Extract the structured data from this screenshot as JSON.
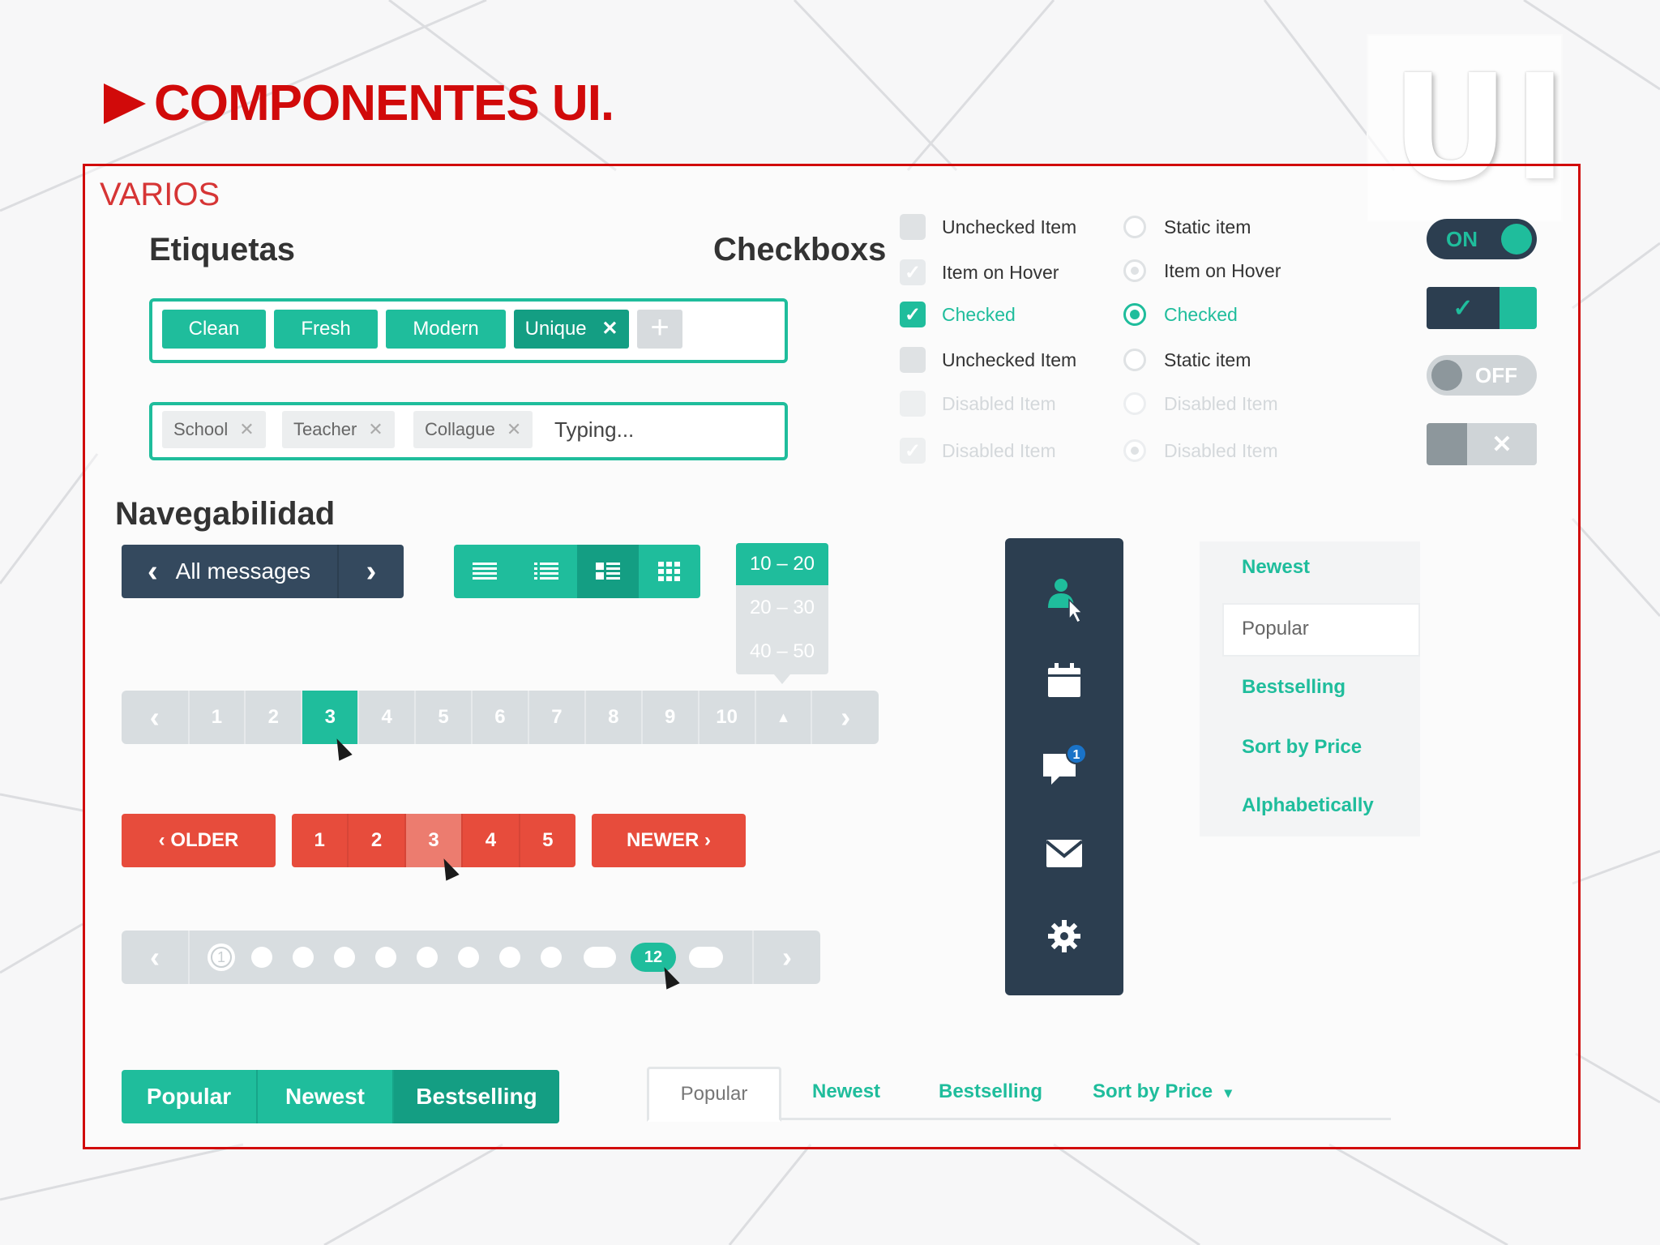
{
  "slide": {
    "title": "COMPONENTES UI.",
    "logo_text": "UI",
    "section": "VARIOS"
  },
  "colors": {
    "accent": "#1fbd9c",
    "accent_dark": "#149e83",
    "navy": "#2c3e50",
    "red": "#e74c3c",
    "title_red": "#d10a0a"
  },
  "etiquetas": {
    "title": "Etiquetas",
    "tags": [
      "Clean",
      "Fresh",
      "Modern",
      "Unique"
    ],
    "remove_glyph": "✕",
    "add_glyph": "+",
    "grey_tags": [
      "School",
      "Teacher",
      "Collague"
    ],
    "typing": "Typing..."
  },
  "checkboxs": {
    "title": "Checkboxs",
    "checkboxes": [
      "Unchecked Item",
      "Item on Hover",
      "Checked",
      "Unchecked Item",
      "Disabled Item",
      "Disabled Item"
    ],
    "radios": [
      "Static item",
      "Item on Hover",
      "Checked",
      "Static item",
      "Disabled Item",
      "Disabled Item"
    ],
    "check_glyph": "✓"
  },
  "toggles": {
    "on_label": "ON",
    "off_label": "OFF",
    "check_glyph": "✓",
    "x_glyph": "✕"
  },
  "navegabilidad": {
    "title": "Navegabilidad",
    "message_nav": {
      "label": "All messages",
      "prev": "‹",
      "next": "›"
    },
    "range_dropdown": [
      "10 – 20",
      "20 – 30",
      "40 – 50"
    ],
    "pager": {
      "prev": "‹",
      "next": "›",
      "pages": [
        "1",
        "2",
        "3",
        "4",
        "5",
        "6",
        "7",
        "8",
        "9",
        "10"
      ],
      "up": "▲",
      "selected": "3"
    },
    "red_pager": {
      "older": "‹  OLDER",
      "newer": "NEWER  ›",
      "pages": [
        "1",
        "2",
        "3",
        "4",
        "5"
      ],
      "selected": "3"
    },
    "dot_pager": {
      "first": "1",
      "current": "12",
      "prev": "‹",
      "next": "›"
    },
    "sidebar_badge": "1",
    "vertical_menu": [
      "Newest",
      "Popular",
      "Bestselling",
      "Sort by Price",
      "Alphabetically"
    ],
    "green_tabs": [
      "Popular",
      "Newest",
      "Bestselling"
    ],
    "line_tabs": [
      "Popular",
      "Newest",
      "Bestselling",
      "Sort by Price"
    ],
    "dropdown_caret": "▾"
  }
}
